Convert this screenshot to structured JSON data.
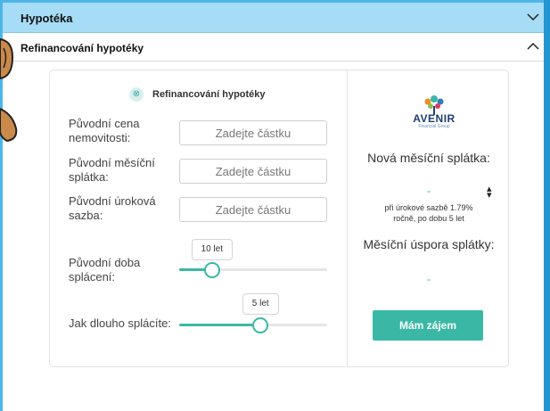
{
  "accordion": {
    "mortgage_title": "Hypotéka",
    "refinance_title": "Refinancování hypotéky"
  },
  "form": {
    "title": "Refinancování hypotéky",
    "fields": [
      {
        "label": "Původní cena nemovitosti:",
        "placeholder": "Zadejte částku"
      },
      {
        "label": "Původní měsíční splátka:",
        "placeholder": "Zadejte částku"
      },
      {
        "label": "Původní úroková sazba:",
        "placeholder": "Zadejte částku"
      }
    ],
    "sliders": [
      {
        "label": "Původní doba splácení:",
        "value_label": "10 let",
        "fraction": 0.22
      },
      {
        "label": "Jak dlouho splácíte:",
        "value_label": "5 let",
        "fraction": 0.55
      }
    ]
  },
  "result": {
    "logo_name": "AVENIR",
    "logo_sub": "Financial Group",
    "new_payment_label": "Nová měsíční splátka:",
    "new_payment_value": "-",
    "rate_note": "při úrokové sazbě 1.79% ročně, po dobu 5 let",
    "saving_label": "Měsíční úspora splátky:",
    "saving_value": "-",
    "cta_label": "Mám zájem"
  },
  "colors": {
    "accent": "#3ab8a5",
    "header_bg": "#a6dcf6",
    "frame": "#2196d3"
  }
}
